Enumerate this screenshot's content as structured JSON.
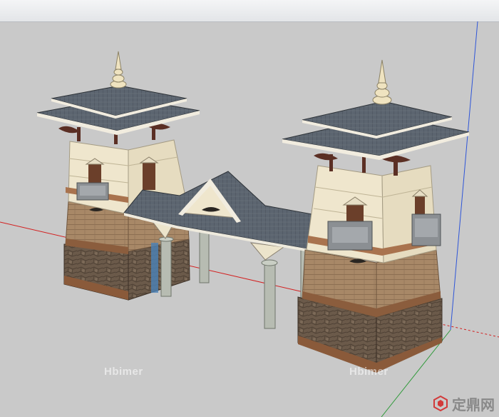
{
  "window": {
    "title": ""
  },
  "watermarks": {
    "left": "Hbimer",
    "right": "Hbimer"
  },
  "logo": {
    "text": "定鼎网",
    "icon": "hexagon-logo-icon"
  },
  "colors": {
    "background": "#c9c9c9",
    "roof": "#5c6570",
    "plaster": "#eee5cc",
    "brick": "#a88867",
    "stone": "#6b5a4a",
    "axis_red": "#d32020",
    "axis_green": "#2f9a3a",
    "axis_blue": "#2e55d8"
  }
}
